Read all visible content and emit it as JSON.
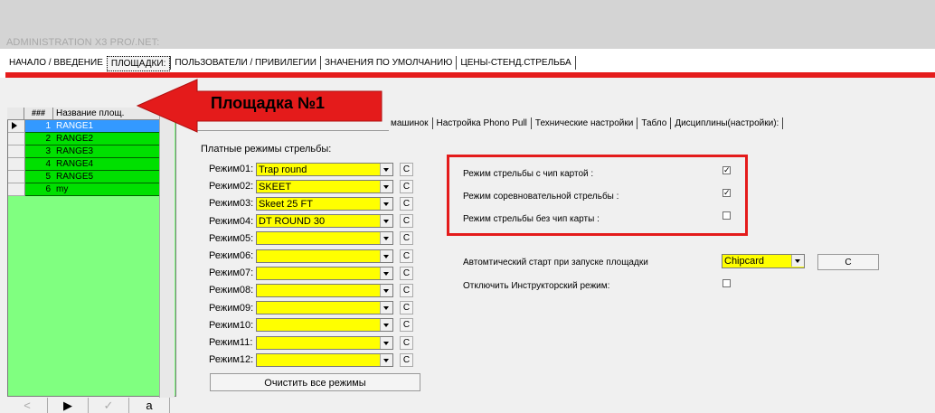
{
  "app_title": "ADMINISTRATION X3 PRO/.NET:",
  "main_tabs": [
    {
      "label": "НАЧАЛО / ВВЕДЕНИЕ",
      "active": false
    },
    {
      "label": "ПЛОЩАДКИ:",
      "active": true
    },
    {
      "label": "ПОЛЬЗОВАТЕЛИ / ПРИВИЛЕГИИ",
      "active": false
    },
    {
      "label": "ЗНАЧЕНИЯ ПО УМОЛЧАНИЮ",
      "active": false
    },
    {
      "label": "ЦЕНЫ-СТЕНД.СТРЕЛЬБА",
      "active": false
    }
  ],
  "grid": {
    "header_num": "###",
    "header_name": "Название площ.",
    "rows": [
      {
        "num": "1",
        "name": "RANGE1",
        "selected": true
      },
      {
        "num": "2",
        "name": "RANGE2",
        "selected": false
      },
      {
        "num": "3",
        "name": "RANGE3",
        "selected": false
      },
      {
        "num": "4",
        "name": "RANGE4",
        "selected": false
      },
      {
        "num": "5",
        "name": "RANGE5",
        "selected": false
      },
      {
        "num": "6",
        "name": "my",
        "selected": false
      }
    ],
    "nav": [
      "<",
      "▶",
      "✓",
      "a"
    ]
  },
  "annotation": {
    "text": "Площадка №1",
    "color": "#e41b1b"
  },
  "sub_tabs": [
    "машинок",
    "Настройка Phono Pull",
    "Технические настройки",
    "Табло",
    "Дисциплины(настройки):"
  ],
  "paid_modes_label": "Платные режимы стрельбы:",
  "modes": [
    {
      "label": "Режим01:",
      "value": "Trap round"
    },
    {
      "label": "Режим02:",
      "value": "SKEET"
    },
    {
      "label": "Режим03:",
      "value": "Skeet 25 FT"
    },
    {
      "label": "Режим04:",
      "value": "DT ROUND 30"
    },
    {
      "label": "Режим05:",
      "value": ""
    },
    {
      "label": "Режим06:",
      "value": ""
    },
    {
      "label": "Режим07:",
      "value": ""
    },
    {
      "label": "Режим08:",
      "value": ""
    },
    {
      "label": "Режим09:",
      "value": ""
    },
    {
      "label": "Режим10:",
      "value": ""
    },
    {
      "label": "Режим11:",
      "value": ""
    },
    {
      "label": "Режим12:",
      "value": ""
    }
  ],
  "mode_clear_btn": "C",
  "clear_all_btn": "Очистить все режимы",
  "options": [
    {
      "label": "Режим стрельбы с чип картой :",
      "checked": true
    },
    {
      "label": "Режим соревновательной стрельбы :",
      "checked": true
    },
    {
      "label": "Режим стрельбы без чип карты :",
      "checked": false
    }
  ],
  "auto_start": {
    "label": "Автомтический старт при запуске площадки",
    "value": "Chipcard",
    "button": "C"
  },
  "instructor": {
    "label": "Отключить Инструкторский режим:",
    "checked": false
  },
  "colors": {
    "highlight_red": "#e41b1b",
    "grid_green": "#00e000",
    "combo_yellow": "#ffff00",
    "selected_blue": "#3399ff"
  }
}
